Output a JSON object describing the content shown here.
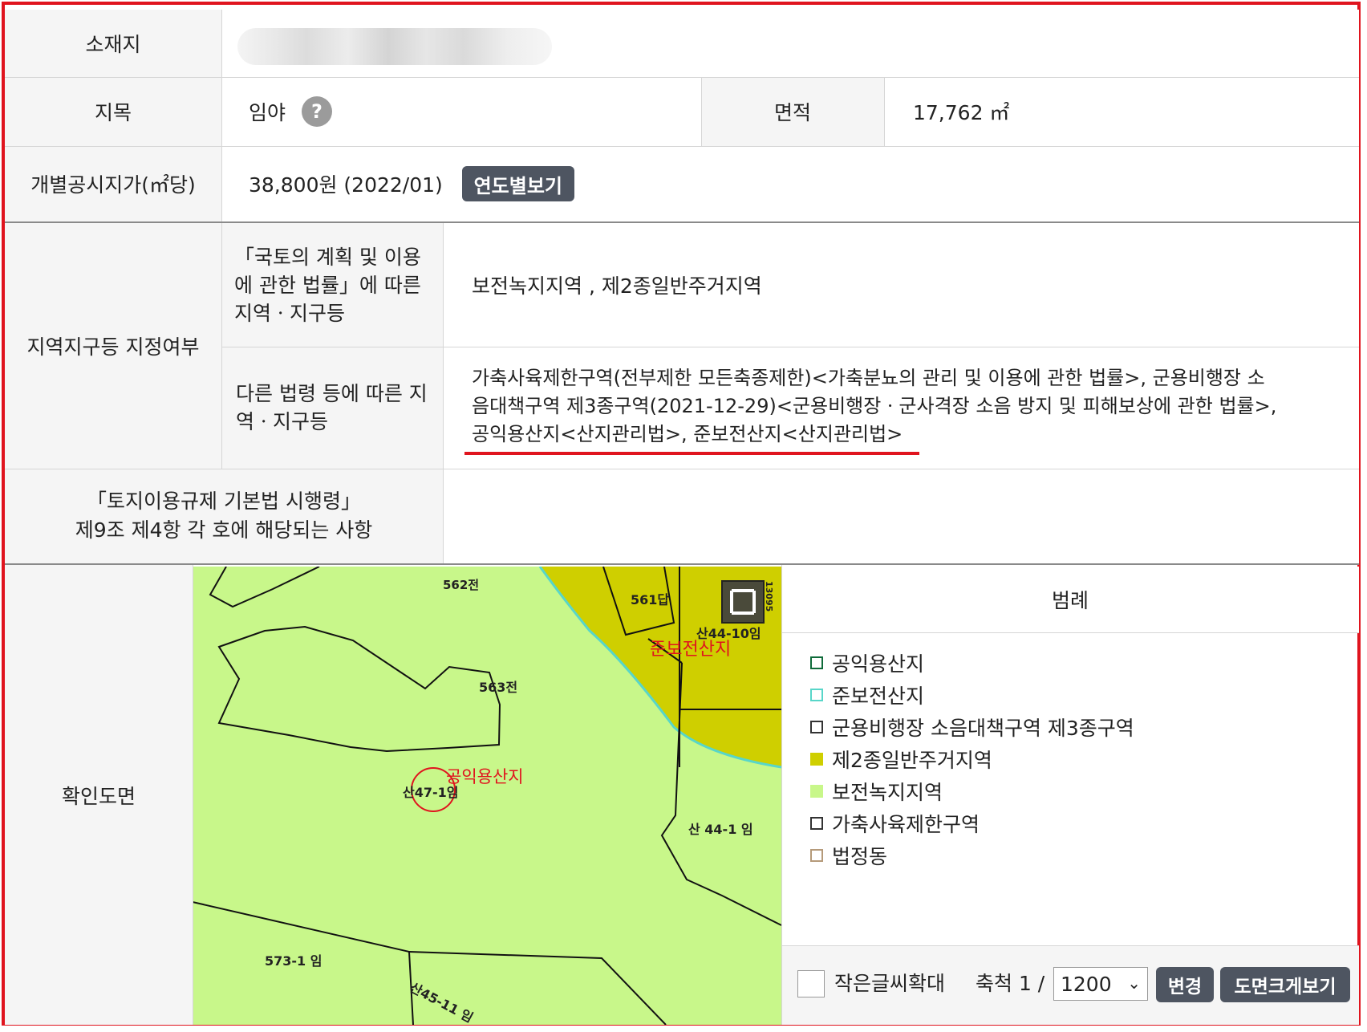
{
  "land": {
    "location_label": "소재지",
    "category_label": "지목",
    "category_value": "임야",
    "help_icon": "question-circle-icon",
    "help_symbol": "?",
    "area_label": "면적",
    "area_value": "17,762 ㎡",
    "price_label": "개별공시지가(㎡당)",
    "price_value": "38,800원 (2022/01)",
    "price_button": "연도별보기"
  },
  "zoning": {
    "main_label": "지역지구등 지정여부",
    "sub1_label": "「국토의 계획 및 이용에 관한 법률」에 따른 지역ㆍ지구등",
    "sub1_value": "보전녹지지역 , 제2종일반주거지역",
    "sub2_label": "다른 법령 등에 따른 지역ㆍ지구등",
    "sub2_line1": "가축사육제한구역(전부제한 모든축종제한)<가축분뇨의 관리 및 이용에 관한 법률>, 군용비행장 소",
    "sub2_line2": "음대책구역 제3종구역(2021-12-29)<군용비행장ㆍ군사격장 소음 방지 및 피해보상에 관한 법률>,",
    "sub2_line3": "공익용산지<산지관리법>, 준보전산지<산지관리법>",
    "regulation_label_line1": "「토지이용규제 기본법 시행령」",
    "regulation_label_line2": "제9조 제4항 각 호에 해당되는 사항",
    "regulation_value": ""
  },
  "map_section": {
    "label": "확인도면",
    "legend_title": "범례",
    "fullscreen_icon": "fullscreen-icon",
    "parcels": {
      "p562": "562전",
      "p561": "561답",
      "p563": "563전",
      "s44_10": "산44-10임",
      "s47_1": "산47-1임",
      "s44_1": "산 44-1 임",
      "p573_1": "573-1 임",
      "s45_11": "산45-11 임",
      "edge": "13095"
    },
    "zone_labels": {
      "semi": "준보전산지",
      "public": "공익용산지"
    },
    "legend": [
      {
        "label": "공익용산지",
        "color": "#0f6b3a",
        "filled": false
      },
      {
        "label": "준보전산지",
        "color": "#58d6c9",
        "filled": false
      },
      {
        "label": "군용비행장 소음대책구역 제3종구역",
        "color": "#333333",
        "filled": false
      },
      {
        "label": "제2종일반주거지역",
        "color": "#cfcf00",
        "filled": true
      },
      {
        "label": "보전녹지지역",
        "color": "#c8f78a",
        "filled": true
      },
      {
        "label": "가축사육제한구역",
        "color": "#333333",
        "filled": false
      },
      {
        "label": "법정동",
        "color": "#b59a7a",
        "filled": false
      }
    ],
    "controls": {
      "checkbox_label": "작은글씨확대",
      "scale_label": "축척 1 /",
      "scale_value": "1200",
      "change_button": "변경",
      "enlarge_button": "도면크게보기"
    },
    "colors": {
      "green_zone": "#c8f78a",
      "yellow_zone": "#cfcf00",
      "annotation_red": "#e0141e"
    }
  }
}
